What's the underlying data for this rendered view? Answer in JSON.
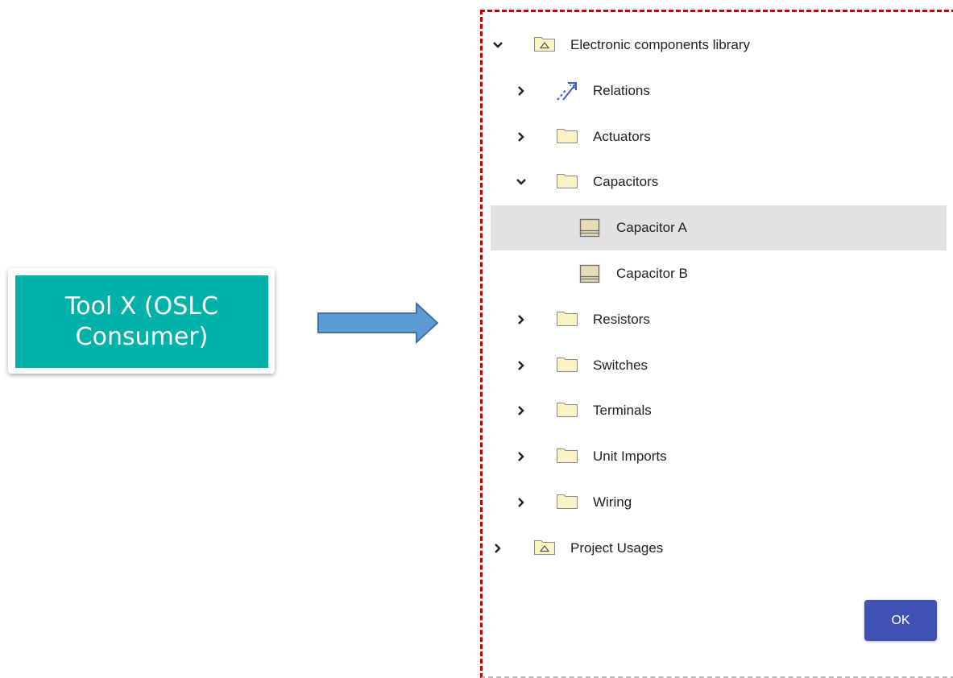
{
  "tool": {
    "label": "Tool X (OSLC Consumer)",
    "color": "#00b2a9"
  },
  "colors": {
    "panel_border": "#c00000",
    "selection": "#e2e2e2",
    "button": "#3f51b5",
    "folder": "#fbf3c5"
  },
  "tree": [
    {
      "label": "Electronic components library",
      "icon": "package-icon",
      "state": "expanded",
      "depth": 0
    },
    {
      "label": "Relations",
      "icon": "relations-icon",
      "state": "collapsed",
      "depth": 1
    },
    {
      "label": "Actuators",
      "icon": "folder-icon",
      "state": "collapsed",
      "depth": 1
    },
    {
      "label": "Capacitors",
      "icon": "folder-icon",
      "state": "expanded",
      "depth": 1
    },
    {
      "label": "Capacitor A",
      "icon": "component-icon",
      "state": "leaf",
      "depth": 2,
      "selected": true
    },
    {
      "label": "Capacitor B",
      "icon": "component-icon",
      "state": "leaf",
      "depth": 2
    },
    {
      "label": "Resistors",
      "icon": "folder-icon",
      "state": "collapsed",
      "depth": 1
    },
    {
      "label": "Switches",
      "icon": "folder-icon",
      "state": "collapsed",
      "depth": 1
    },
    {
      "label": "Terminals",
      "icon": "folder-icon",
      "state": "collapsed",
      "depth": 1
    },
    {
      "label": "Unit Imports",
      "icon": "folder-icon",
      "state": "collapsed",
      "depth": 1
    },
    {
      "label": "Wiring",
      "icon": "folder-icon",
      "state": "collapsed",
      "depth": 1
    },
    {
      "label": "Project Usages",
      "icon": "package-icon",
      "state": "collapsed",
      "depth": 0
    }
  ],
  "ok_button": {
    "label": "OK"
  }
}
